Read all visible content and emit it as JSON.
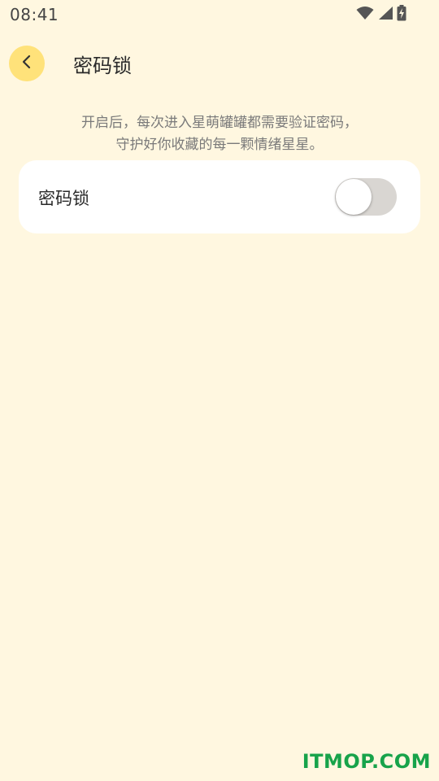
{
  "status_bar": {
    "time": "08:41",
    "icons": [
      "wifi-icon",
      "signal-icon",
      "battery-charging-icon"
    ]
  },
  "header": {
    "title": "密码锁",
    "back_icon": "chevron-left-icon"
  },
  "description": {
    "line1": "开启后，每次进入星萌罐罐都需要验证密码，",
    "line2": "守护好你收藏的每一颗情绪星星。"
  },
  "setting": {
    "label": "密码锁",
    "enabled": false
  },
  "watermark": "ITMOP.COM",
  "colors": {
    "background": "#FFF7E0",
    "back_button": "#FFE27A",
    "card": "#FFFFFF",
    "toggle_off": "#D9D6D2",
    "watermark": "#17A34A"
  }
}
